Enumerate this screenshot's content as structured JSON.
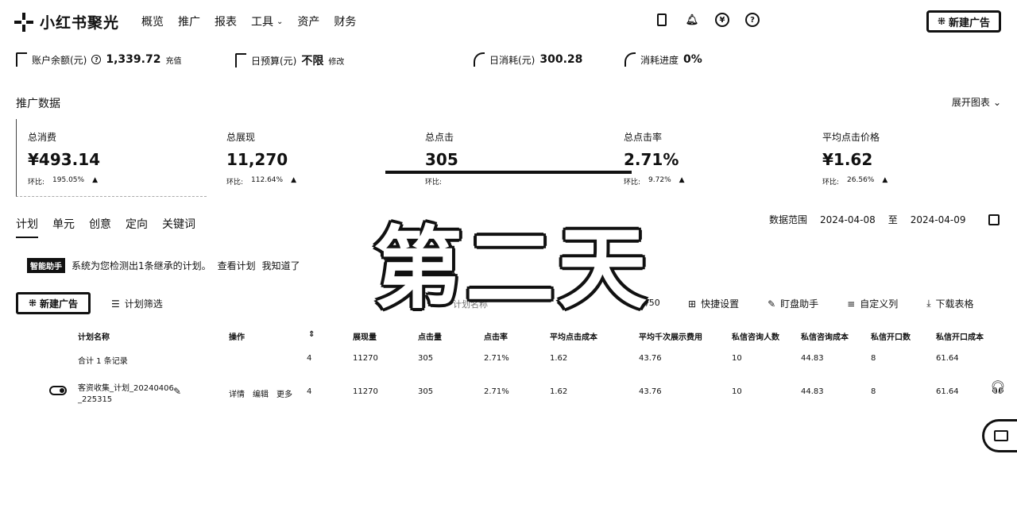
{
  "app": {
    "name": "小红书聚光"
  },
  "nav": {
    "items": [
      {
        "label": "概览"
      },
      {
        "label": "推广"
      },
      {
        "label": "报表"
      },
      {
        "label": "工具",
        "dropdown": true
      },
      {
        "label": "资产"
      },
      {
        "label": "财务"
      }
    ]
  },
  "top_icons": [
    "tablet-icon",
    "bell-icon",
    "yen-icon",
    "help-icon"
  ],
  "new_button": {
    "label": "新建广告"
  },
  "account": {
    "balance_label": "账户余额(元)",
    "balance_value": "1,339.72",
    "balance_action": "充值",
    "budget_label": "日预算(元)",
    "budget_value": "不限",
    "budget_action": "修改",
    "daily_spend_label": "日消耗(元)",
    "daily_spend_value": "300.28",
    "progress_label": "消耗进度",
    "progress_value": "0%"
  },
  "promo": {
    "title": "推广数据",
    "expand_label": "展开图表"
  },
  "metrics": [
    {
      "label": "总消费",
      "value": "¥493.14",
      "cmp_label": "环比:",
      "cmp_value": "195.05%"
    },
    {
      "label": "总展现",
      "value": "11,270",
      "cmp_label": "环比:",
      "cmp_value": "112.64%"
    },
    {
      "label": "总点击",
      "value": "305",
      "cmp_label": "环比:",
      "cmp_value": ""
    },
    {
      "label": "总点击率",
      "value": "2.71%",
      "cmp_label": "环比:",
      "cmp_value": "9.72%"
    },
    {
      "label": "平均点击价格",
      "value": "¥1.62",
      "cmp_label": "环比:",
      "cmp_value": "26.56%"
    }
  ],
  "tabs": [
    {
      "label": "计划",
      "active": true
    },
    {
      "label": "单元"
    },
    {
      "label": "创意"
    },
    {
      "label": "定向"
    },
    {
      "label": "关键词"
    }
  ],
  "date_range": {
    "label": "数据范围",
    "start": "2024-04-08",
    "sep": "至",
    "end": "2024-04-09"
  },
  "notice": {
    "tag": "智能助手",
    "text": "系统为您检测出1条继承的计划。",
    "link1": "查看计划",
    "link2": "我知道了"
  },
  "watermark": "第二天",
  "toolbar": {
    "new_label": "新建广告",
    "filter_label": "计划筛选",
    "search_placeholder": "计划名称",
    "counter": "0/50",
    "tools": [
      {
        "label": "快捷设置",
        "icon": "grid-icon"
      },
      {
        "label": "盯盘助手",
        "icon": "edit-icon"
      },
      {
        "label": "自定义列",
        "icon": "list-icon"
      },
      {
        "label": "下载表格",
        "icon": "download-icon"
      }
    ]
  },
  "table": {
    "headers": [
      "计划名称",
      "操作",
      "展现量",
      "点击量",
      "点击率",
      "平均点击成本",
      "平均千次展示费用",
      "私信咨询人数",
      "私信咨询成本",
      "私信开口数",
      "私信开口成本"
    ],
    "total_row": {
      "name": "合计 1 条记录",
      "count": "4",
      "impressions": "11270",
      "clicks": "305",
      "ctr": "2.71%",
      "cpc": "1.62",
      "cpm": "43.76",
      "dm_users": "10",
      "dm_cost": "44.83",
      "dm_opens": "8",
      "dm_open_cost": "61.64"
    },
    "rows": [
      {
        "name_line1": "客资收集_计划_20240406",
        "name_line2": "_225315",
        "actions": [
          "详情",
          "编辑",
          "更多"
        ],
        "count": "4",
        "impressions": "11270",
        "clicks": "305",
        "ctr": "2.71%",
        "cpc": "1.62",
        "cpm": "43.76",
        "dm_users": "10",
        "dm_cost": "44.83",
        "dm_opens": "8",
        "dm_open_cost": "61.64"
      }
    ]
  }
}
